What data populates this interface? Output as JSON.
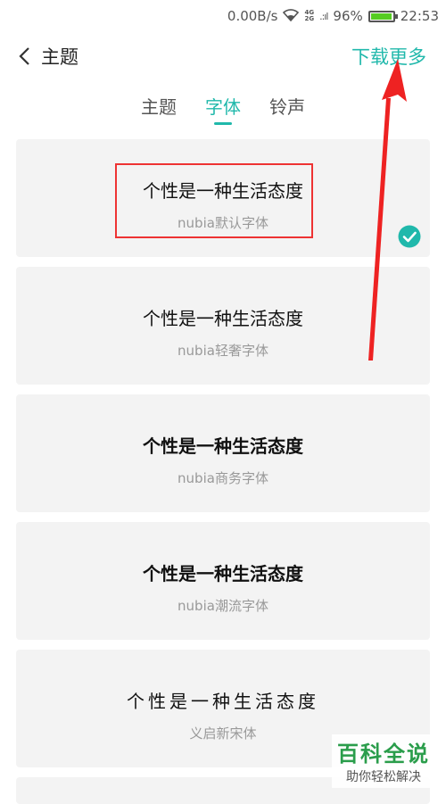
{
  "status_bar": {
    "speed": "0.00B/s",
    "network_top": "4G",
    "network_bottom": "2G",
    "battery": "96%",
    "battery_level": 0.96,
    "time": "22:53"
  },
  "header": {
    "title": "主题",
    "more_label": "下载更多"
  },
  "tabs": [
    {
      "label": "主题",
      "active": false
    },
    {
      "label": "字体",
      "active": true
    },
    {
      "label": "铃声",
      "active": false
    }
  ],
  "fonts": [
    {
      "preview": "个性是一种生活态度",
      "name": "nubia默认字体",
      "selected": true
    },
    {
      "preview": "个性是一种生活态度",
      "name": "nubia轻奢字体",
      "selected": false
    },
    {
      "preview": "个性是一种生活态度",
      "name": "nubia商务字体",
      "selected": false
    },
    {
      "preview": "个性是一种生活态度",
      "name": "nubia潮流字体",
      "selected": false
    },
    {
      "preview": "个性是一种生活态度",
      "name": "义启新宋体",
      "selected": false
    }
  ],
  "watermark": {
    "main": "百科全说",
    "sub": "助你轻松解决"
  },
  "colors": {
    "accent": "#20b8ab",
    "annotation": "#ee3333"
  }
}
